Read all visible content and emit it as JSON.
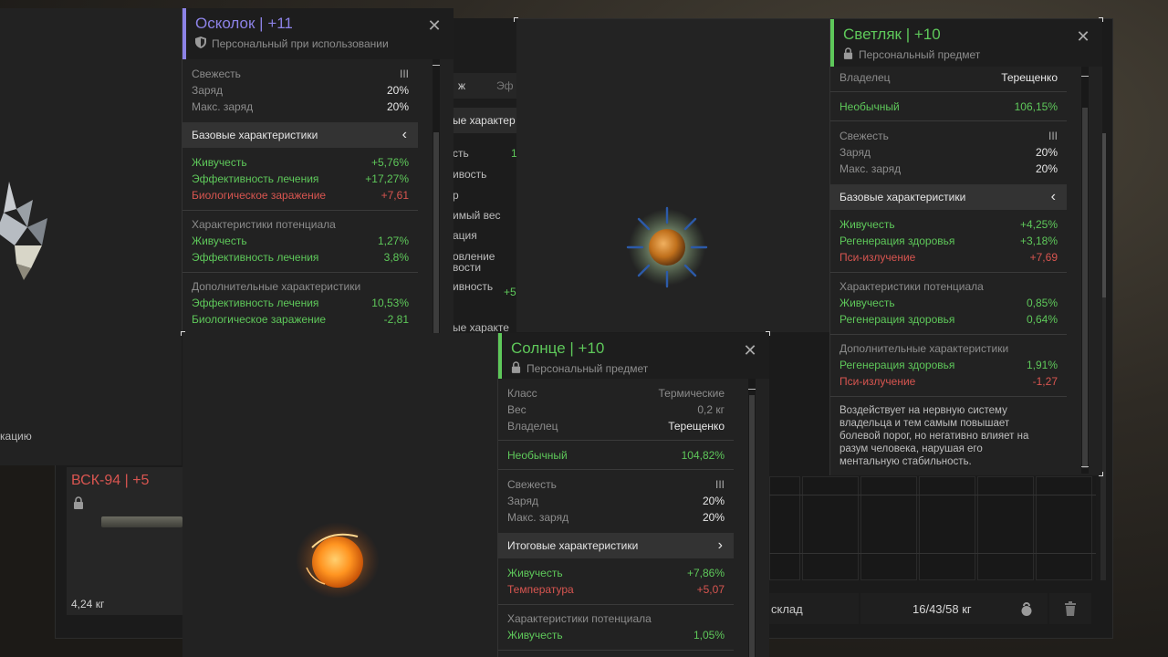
{
  "shard_card": {
    "title_name": "Осколок",
    "title_sep": " | ",
    "title_level": "+11",
    "subtitle": "Персональный при использовании",
    "rows1": [
      {
        "label": "Свежесть",
        "value": "III"
      },
      {
        "label": "Заряд",
        "value": "20%"
      },
      {
        "label": "Макс. заряд",
        "value": "20%"
      }
    ],
    "base_header": "Базовые характеристики",
    "base_chevron": "‹",
    "base_stats": [
      {
        "label": "Живучесть",
        "value": "+5,76%"
      },
      {
        "label": "Эффективность лечения",
        "value": "+17,27%"
      },
      {
        "label": "Биологическое заражение",
        "value": "+7,61"
      }
    ],
    "potential_header": "Характеристики потенциала",
    "potential_stats": [
      {
        "label": "Живучесть",
        "value": "1,27%"
      },
      {
        "label": "Эффективность лечения",
        "value": "3,8%"
      }
    ],
    "extra_header": "Дополнительные характеристики",
    "extra_stats": [
      {
        "label": "Эффективность лечения",
        "value": "10,53%"
      },
      {
        "label": "Биологическое заражение",
        "value": "-2,81"
      }
    ]
  },
  "glow_card": {
    "title_name": "Светляк",
    "title_sep": " | ",
    "title_level": "+10",
    "subtitle": "Персональный предмет",
    "owner_label": "Владелец",
    "owner_value": "Терещенко",
    "rarity_label": "Необычный",
    "rarity_value": "106,15%",
    "rows1": [
      {
        "label": "Свежесть",
        "value": "III"
      },
      {
        "label": "Заряд",
        "value": "20%"
      },
      {
        "label": "Макс. заряд",
        "value": "20%"
      }
    ],
    "base_header": "Базовые характеристики",
    "base_chevron": "‹",
    "base_stats": [
      {
        "label": "Живучесть",
        "value": "+4,25%"
      },
      {
        "label": "Регенерация здоровья",
        "value": "+3,18%"
      },
      {
        "label": "Пси-излучение",
        "value": "+7,69"
      }
    ],
    "potential_header": "Характеристики потенциала",
    "potential_stats": [
      {
        "label": "Живучесть",
        "value": "0,85%"
      },
      {
        "label": "Регенерация здоровья",
        "value": "0,64%"
      }
    ],
    "extra_header": "Дополнительные характеристики",
    "extra_stats": [
      {
        "label": "Регенерация здоровья",
        "value": "1,91%"
      },
      {
        "label": "Пси-излучение",
        "value": "-1,27"
      }
    ],
    "description_lines": [
      "Воздействует на нервную систему",
      "владельца и тем самым повышает",
      "болевой порог, но негативно влияет на",
      "разум человека, нарушая его",
      "ментальную стабильность."
    ]
  },
  "sun_card": {
    "title_name": "Солнце",
    "title_sep": " | ",
    "title_level": "+10",
    "subtitle": "Персональный предмет",
    "info_rows": [
      {
        "label": "Класс",
        "value": "Термические"
      },
      {
        "label": "Вес",
        "value": "0,2 кг"
      },
      {
        "label": "Владелец",
        "value": "Терещенко"
      }
    ],
    "rarity_label": "Необычный",
    "rarity_value": "104,82%",
    "rows1": [
      {
        "label": "Свежесть",
        "value": "III"
      },
      {
        "label": "Заряд",
        "value": "20%"
      },
      {
        "label": "Макс. заряд",
        "value": "20%"
      }
    ],
    "total_header": "Итоговые характеристики",
    "total_chevron": "›",
    "total_stats": [
      {
        "label": "Живучесть",
        "value": "+7,86%"
      },
      {
        "label": "Температура",
        "value": "+5,07"
      }
    ],
    "potential_header": "Характеристики потенциала",
    "potential_stats": [
      {
        "label": "Живучесть",
        "value": "1,05%"
      }
    ]
  },
  "background": {
    "left_fragment": "кацию",
    "weapon_name": "ВСК-94",
    "weapon_sep": " | ",
    "weapon_level": "+5",
    "weapon_weight": "4,24 кг",
    "tab_fragment_1": "ж",
    "tab_fragment_2": "Эф",
    "mid_fragments": [
      "ые характер",
      "сть",
      "ивость",
      "р",
      "имый вес",
      "ация",
      "овление",
      "вости",
      "ивность",
      "ые характе"
    ],
    "mid_value_fragment": "+5",
    "mid_value_fragment2": "1",
    "footer_label": "склад",
    "footer_weight": "16/43/58 кг"
  },
  "colors": {
    "shard_accent": "#8c82e6",
    "glow_accent": "#5ec85a",
    "sun_accent": "#5ec85a",
    "positive": "#5ec85a",
    "negative": "#d85550"
  },
  "icons": [
    "shield-icon",
    "lock-icon",
    "close-icon",
    "kettlebell-icon",
    "trash-icon",
    "crystal-artifact",
    "sun-artifact",
    "firefly-artifact",
    "rifle-image"
  ]
}
